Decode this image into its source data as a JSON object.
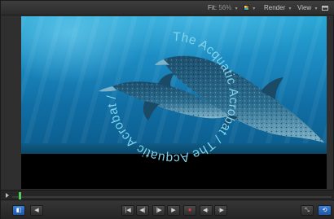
{
  "toolbar": {
    "fit_label": "Fit:",
    "fit_value": "56%",
    "render_label": "Render",
    "view_label": "View",
    "caret": "▾"
  },
  "canvas": {
    "circular_text": "The Acquatic Acrobat / The Acquatic Acrobat / ",
    "text_color": "#7fd3ec"
  },
  "transport": {
    "icons": [
      "safe-zones-icon",
      "go-to-start-icon",
      "previous-frame-icon",
      "next-frame-icon",
      "play-icon",
      "record-icon",
      "mute-icon",
      "end-icon",
      "fullscreen-icon",
      "loop-icon"
    ],
    "glyphs": {
      "safe_zones": "◧",
      "step_back": "◀",
      "go_start": "|◀",
      "go_prev": "◀|",
      "go_next": "|▶",
      "play": "▶",
      "record": "⏺",
      "prev_mark": "◀·",
      "next_mark": "·▶",
      "fullscreen": "⤡",
      "loop": "⟲"
    }
  }
}
